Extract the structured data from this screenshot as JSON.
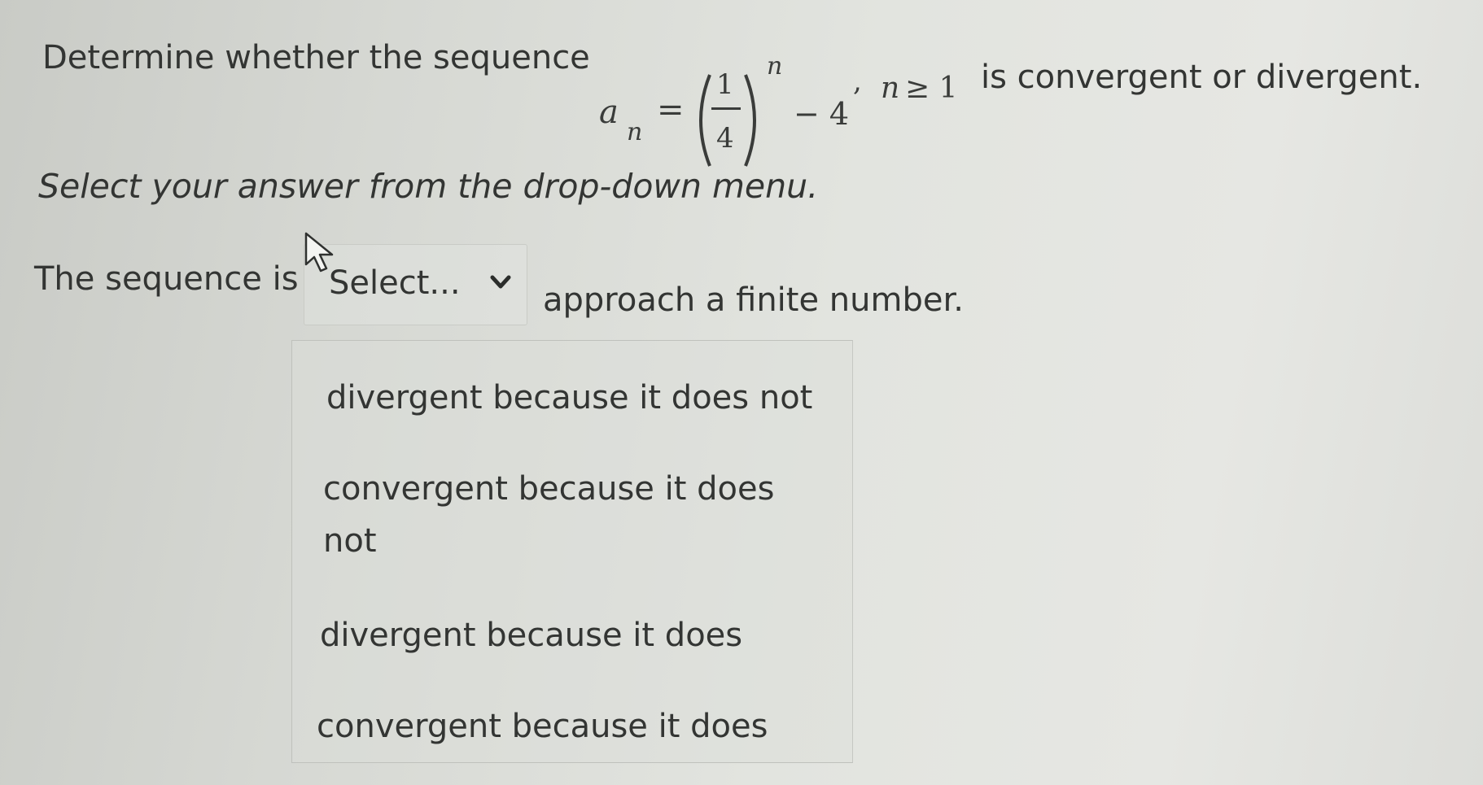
{
  "question": {
    "prefix": "Determine whether the sequence",
    "suffix": "is convergent or divergent.",
    "formula": {
      "lhs_var": "a",
      "lhs_sub": "n",
      "equals": "=",
      "frac_num": "1",
      "frac_den": "4",
      "exponent": "n",
      "minus_term": "− 4",
      "comma": ",",
      "condition_var": "n",
      "condition_rest": "≥ 1"
    }
  },
  "instruction": "Select your answer from the drop-down menu.",
  "answer": {
    "prefix": "The sequence is",
    "select_value": "Select...",
    "suffix": "approach a finite number."
  },
  "dropdown": {
    "options": [
      {
        "line1": "divergent because it does not",
        "line2": ""
      },
      {
        "line1": "convergent because it does",
        "line2": "not"
      },
      {
        "line1": "divergent because it does",
        "line2": ""
      },
      {
        "line1": "convergent because it does",
        "line2": ""
      }
    ]
  },
  "icons": {
    "select_chevron": "chevron-down-icon",
    "pointer": "mouse-cursor-icon"
  },
  "colors": {
    "text": "#333533",
    "chevron": "#2b2d2b"
  }
}
